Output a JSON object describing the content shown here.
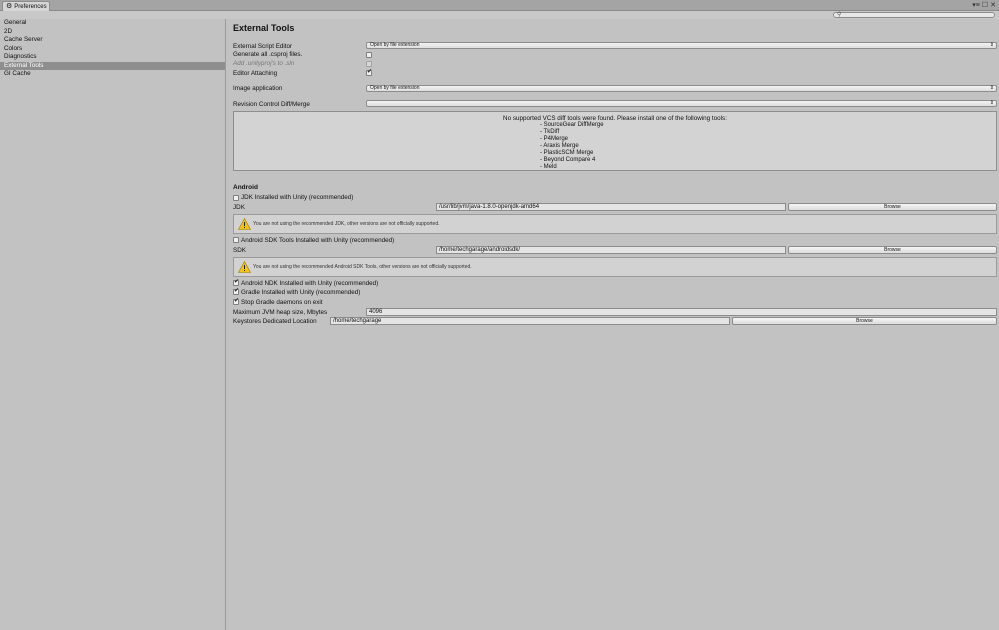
{
  "window": {
    "tab_title": "Preferences",
    "controls": [
      "▾≡",
      "☐",
      "✕"
    ]
  },
  "search": {
    "placeholder": ""
  },
  "sidebar": {
    "items": [
      "General",
      "2D",
      "Cache Server",
      "Colors",
      "Diagnostics",
      "External Tools",
      "GI Cache"
    ],
    "active": "External Tools"
  },
  "main": {
    "title": "External Tools",
    "script_editor_label": "External Script Editor",
    "script_editor_value": "Open by file extension",
    "gen_csproj_label": "Generate all .csproj files.",
    "add_unityproj_label": "Add .unityproj's to .sln",
    "editor_attaching_label": "Editor Attaching",
    "image_app_label": "Image application",
    "image_app_value": "Open by file extension",
    "revision_label": "Revision Control Diff/Merge",
    "revision_value": "",
    "vcs_message": "No supported VCS diff tools were found. Please install one of the following tools:",
    "vcs_tools": [
      "- SourceGear DiffMerge",
      "- TkDiff",
      "- P4Merge",
      "- Araxis Merge",
      "- PlasticSCM Merge",
      "- Beyond Compare 4",
      "- Meld"
    ],
    "android_header": "Android",
    "jdk_installed_label": "JDK Installed with Unity (recommended)",
    "jdk_label": "JDK",
    "jdk_path": "/usr/lib/jvm/java-1.8.0-openjdk-amd64",
    "browse_label": "Browse",
    "jdk_warning": "You are not using the recommended JDK, other versions are not officially supported.",
    "sdk_installed_label": "Android SDK Tools Installed with Unity (recommended)",
    "sdk_label": "SDK",
    "sdk_path": "/home/techgarage/androidsdk/",
    "sdk_warning": "You are not using the recommended Android SDK Tools, other versions are not officially supported.",
    "ndk_label": "Android NDK Installed with Unity (recommended)",
    "gradle_label": "Gradle Installed with Unity (recommended)",
    "stop_gradle_label": "Stop Gradle daemons on exit",
    "jvm_heap_label": "Maximum JVM heap size, Mbytes",
    "jvm_heap_value": "4096",
    "keystores_label": "Keystores Dedicated Location",
    "keystores_path": "/home/techgarage"
  }
}
